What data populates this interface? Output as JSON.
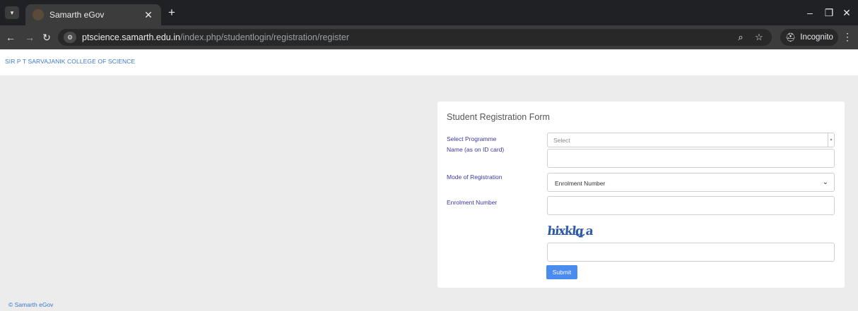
{
  "browser": {
    "tab_title": "Samarth eGov",
    "url_host": "ptscience.samarth.edu.in",
    "url_path": "/index.php/studentlogin/registration/register",
    "incognito_label": "Incognito"
  },
  "header": {
    "college_name": "SIR P T SARVAJANIK COLLEGE OF SCIENCE"
  },
  "form": {
    "title": "Student Registration Form",
    "programme": {
      "label": "Select Programme",
      "placeholder": "Select"
    },
    "name": {
      "label": "Name (as on ID card)",
      "value": ""
    },
    "mode": {
      "label": "Mode of Registration",
      "selected": "Enrolment Number"
    },
    "enrolment": {
      "label": "Enrolment Number",
      "value": ""
    },
    "captcha_text": "hixklq a",
    "captcha_input": {
      "value": ""
    },
    "submit_label": "Submit"
  },
  "footer": {
    "copyright": "© Samarth eGov"
  },
  "colors": {
    "link": "#3c78c8",
    "label": "#3a3aa0",
    "primary_button": "#4a8bf0",
    "captcha": "#2f5aa8"
  }
}
